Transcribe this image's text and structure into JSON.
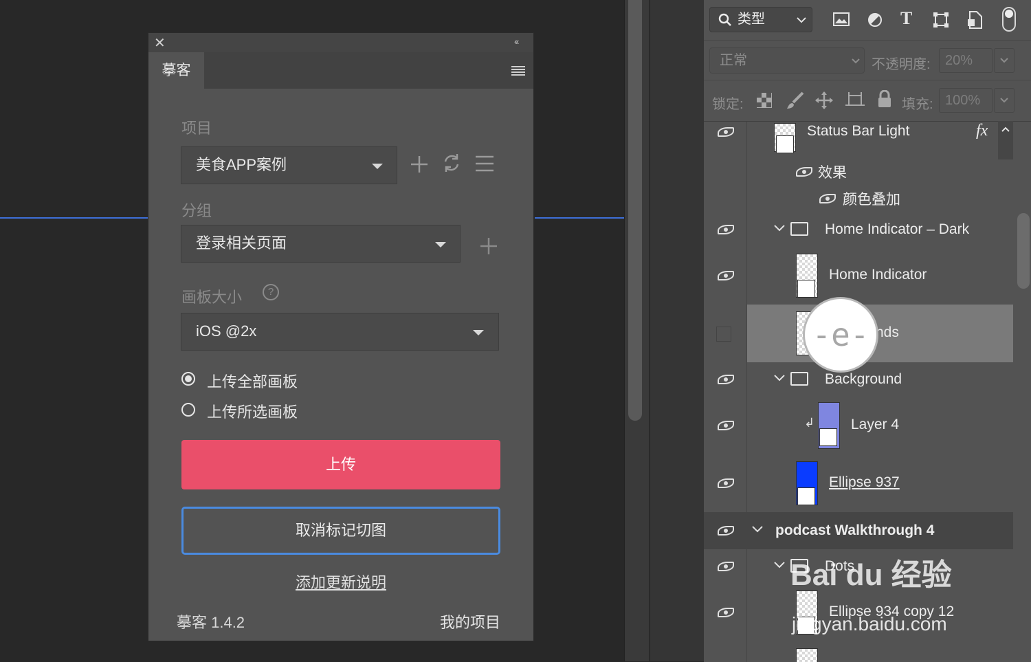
{
  "plugin": {
    "tab_title": "摹客",
    "project_label": "项目",
    "project_value": "美食APP案例",
    "group_label": "分组",
    "group_value": "登录相关页面",
    "size_label": "画板大小",
    "size_help": "?",
    "size_value": "iOS @2x",
    "radio_all": "上传全部画板",
    "radio_selected": "上传所选画板",
    "upload_button": "上传",
    "cancel_button": "取消标记切图",
    "add_notes_link": "添加更新说明",
    "version": "摹客 1.4.2",
    "my_projects": "我的项目",
    "close_glyph": "✕",
    "collapse_glyph": "‹‹"
  },
  "layers": {
    "filter": "类型",
    "blend_mode": "正常",
    "opacity_label": "不透明度:",
    "opacity_value": "20%",
    "lock_label": "锁定:",
    "fill_label": "填充:",
    "fill_value": "100%",
    "rows": [
      {
        "name": "Status Bar Light",
        "fx": "fx"
      },
      {
        "name": "效果"
      },
      {
        "name": "颜色叠加"
      },
      {
        "name": "Home Indicator – Dark"
      },
      {
        "name": "Home Indicator"
      },
      {
        "name": "nds"
      },
      {
        "name": "Background"
      },
      {
        "name": "Layer 4"
      },
      {
        "name": "Ellipse 937"
      },
      {
        "name": "podcast Walkthrough 4"
      },
      {
        "name": "Dots"
      },
      {
        "name": "Ellipse 934 copy 12"
      }
    ],
    "cursor_letter": "-e-"
  },
  "watermark": {
    "brand": "Bai  du 经验",
    "url": "jingyan.baidu.com"
  },
  "colors": {
    "upload": "#ea4f6a",
    "cancel_border": "#4a8be0",
    "guide": "#3e6fd8",
    "ellipse_fill": "#0a3cff"
  }
}
